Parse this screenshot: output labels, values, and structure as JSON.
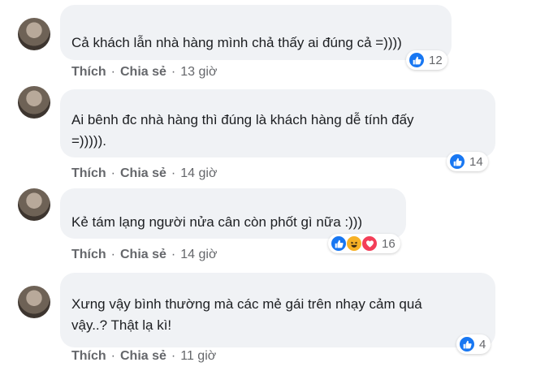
{
  "comments": [
    {
      "text_lines": [
        "Cả khách lẫn nhà hàng mình chả thấy ai đúng cả =))))"
      ],
      "reactions": [
        "like"
      ],
      "reaction_count": "12",
      "like_label": "Thích",
      "share_label": "Chia sẻ",
      "separator": "·",
      "time": "13 giờ"
    },
    {
      "text_lines": [
        "Ai bênh đc nhà hàng thì đúng là khách hàng dễ tính đấy",
        "=)))))."
      ],
      "reactions": [
        "like"
      ],
      "reaction_count": "14",
      "like_label": "Thích",
      "share_label": "Chia sẻ",
      "separator": "·",
      "time": "14 giờ"
    },
    {
      "text_lines": [
        "Kẻ tám lạng người nửa cân còn phốt gì nữa :)))"
      ],
      "reactions": [
        "like",
        "haha",
        "love"
      ],
      "reaction_count": "16",
      "like_label": "Thích",
      "share_label": "Chia sẻ",
      "separator": "·",
      "time": "14 giờ"
    },
    {
      "text_lines": [
        "Xưng vậy bình thường mà các mẻ gái trên nhạy cảm quá",
        "vậy..? Thật lạ kì!"
      ],
      "reactions": [
        "like"
      ],
      "reaction_count": "4",
      "like_label": "Thích",
      "share_label": "Chia sẻ",
      "separator": "·",
      "time": "11 giờ"
    }
  ],
  "colors": {
    "bubble_bg": "#f0f2f5",
    "meta_text": "#65676b",
    "like_blue": "#1877f2",
    "haha_yellow": "#f7b125",
    "love_red": "#f33e58"
  }
}
